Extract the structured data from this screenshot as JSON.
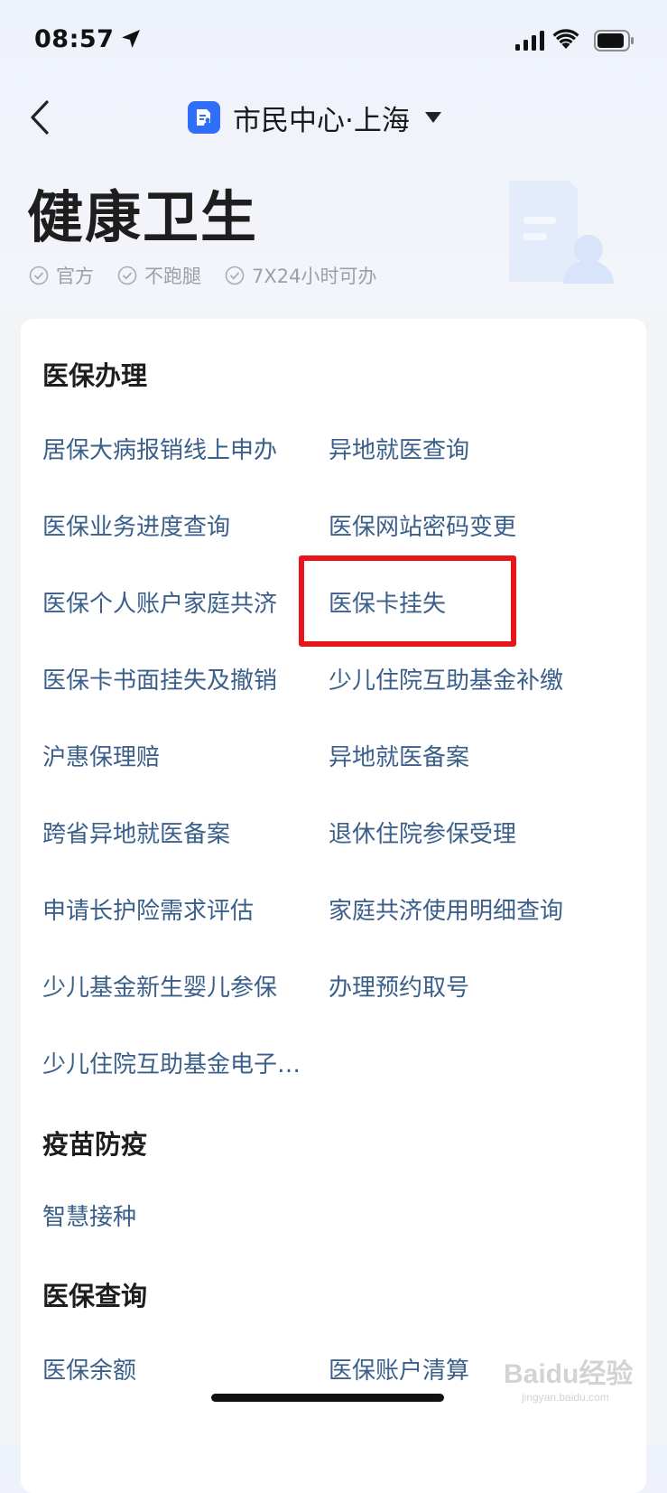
{
  "status_bar": {
    "time": "08:57",
    "icons": [
      "location-arrow-icon",
      "cellular-signal-icon",
      "wifi-icon",
      "battery-icon"
    ]
  },
  "nav": {
    "title": "市民中心·上海",
    "back_icon": "chevron-left-icon",
    "dropdown_icon": "caret-down-icon",
    "accent_color": "#2f6ef6"
  },
  "hero": {
    "title": "健康卫生",
    "tags": [
      "官方",
      "不跑腿",
      "7X24小时可办"
    ]
  },
  "sections": [
    {
      "title": "医保办理",
      "items": [
        "居保大病报销线上申办",
        "异地就医查询",
        "医保业务进度查询",
        "医保网站密码变更",
        "医保个人账户家庭共济",
        "医保卡挂失",
        "医保卡书面挂失及撤销",
        "少儿住院互助基金补缴",
        "沪惠保理赔",
        "异地就医备案",
        "跨省异地就医备案",
        "退休住院参保受理",
        "申请长护险需求评估",
        "家庭共济使用明细查询",
        "少儿基金新生婴儿参保",
        "办理预约取号",
        "少儿住院互助基金电子…"
      ]
    },
    {
      "title": "疫苗防疫",
      "items": [
        "智慧接种"
      ]
    },
    {
      "title": "医保查询",
      "items": [
        "医保余额",
        "医保账户清算"
      ]
    }
  ],
  "highlight": {
    "item": "医保卡挂失",
    "color": "#e8161b"
  },
  "colors": {
    "link_text": "#3a5f8a",
    "heading_text": "#1e1e1e",
    "tag_text": "#9aa0aa"
  },
  "watermark": {
    "main": "Baidu经验",
    "sub": "jingyan.baidu.com"
  }
}
